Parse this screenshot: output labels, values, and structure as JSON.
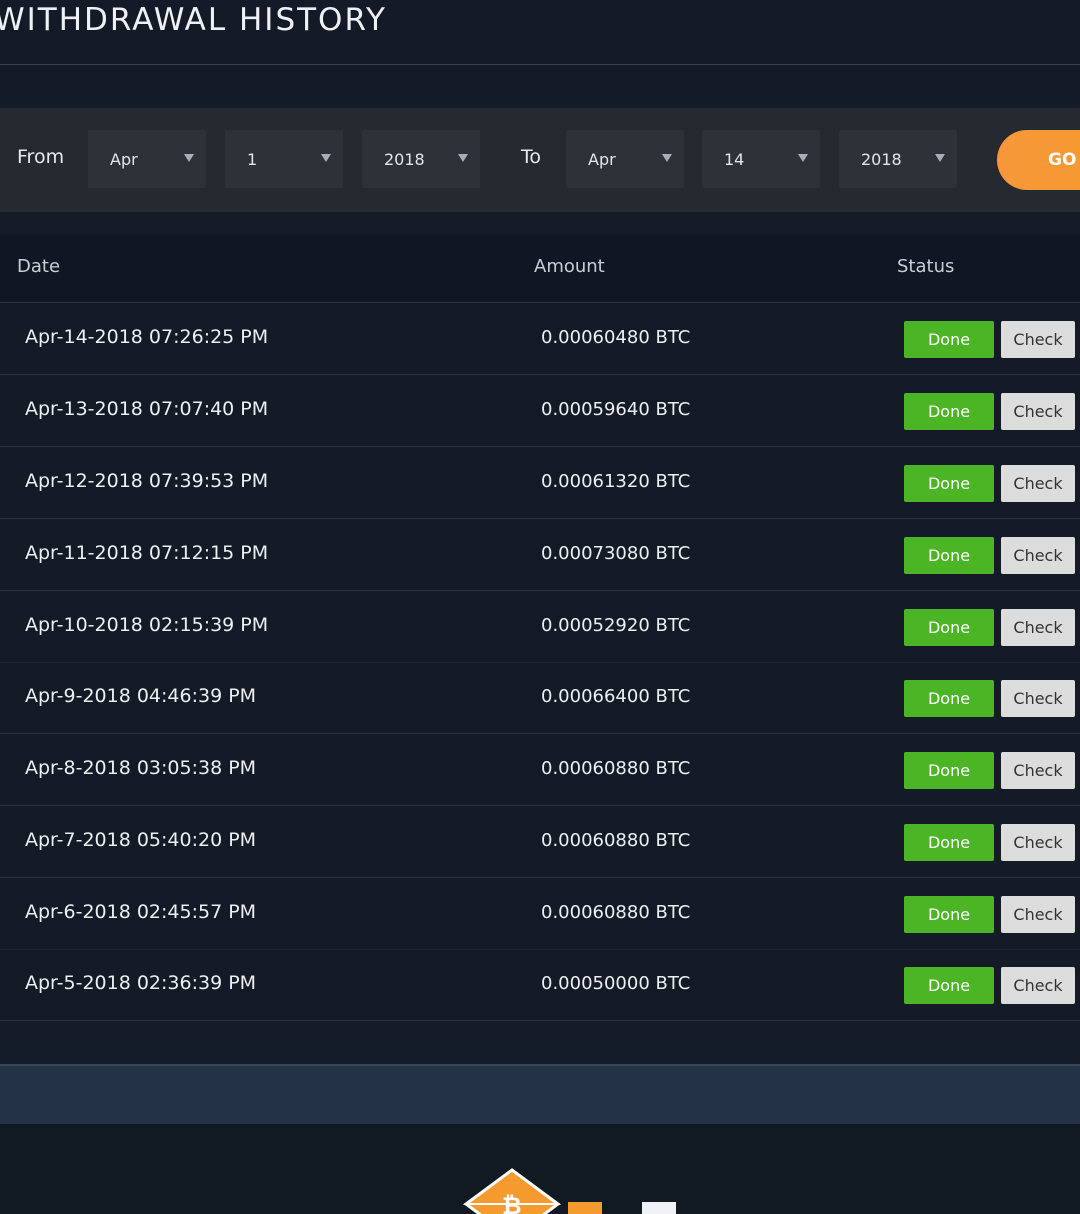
{
  "page": {
    "title": "WITHDRAWAL HISTORY"
  },
  "filter": {
    "from_label": "From",
    "to_label": "To",
    "from_month": "Apr",
    "from_day": "1",
    "from_year": "2018",
    "to_month": "Apr",
    "to_day": "14",
    "to_year": "2018",
    "go_label": "GO",
    "accent_color": "#f7973a"
  },
  "table": {
    "headers": {
      "date": "Date",
      "amount": "Amount",
      "status": "Status"
    },
    "done_color": "#4cb526",
    "rows": [
      {
        "date": "Apr-14-2018 07:26:25 PM",
        "amount": "0.00060480 BTC",
        "status": "Done",
        "action": "Check"
      },
      {
        "date": "Apr-13-2018 07:07:40 PM",
        "amount": "0.00059640 BTC",
        "status": "Done",
        "action": "Check"
      },
      {
        "date": "Apr-12-2018 07:39:53 PM",
        "amount": "0.00061320 BTC",
        "status": "Done",
        "action": "Check"
      },
      {
        "date": "Apr-11-2018 07:12:15 PM",
        "amount": "0.00073080 BTC",
        "status": "Done",
        "action": "Check"
      },
      {
        "date": "Apr-10-2018 02:15:39 PM",
        "amount": "0.00052920 BTC",
        "status": "Done",
        "action": "Check"
      },
      {
        "date": "Apr-9-2018 04:46:39 PM",
        "amount": "0.00066400 BTC",
        "status": "Done",
        "action": "Check"
      },
      {
        "date": "Apr-8-2018 03:05:38 PM",
        "amount": "0.00060880 BTC",
        "status": "Done",
        "action": "Check"
      },
      {
        "date": "Apr-7-2018 05:40:20 PM",
        "amount": "0.00060880 BTC",
        "status": "Done",
        "action": "Check"
      },
      {
        "date": "Apr-6-2018 02:45:57 PM",
        "amount": "0.00060880 BTC",
        "status": "Done",
        "action": "Check"
      },
      {
        "date": "Apr-5-2018 02:36:39 PM",
        "amount": "0.00050000 BTC",
        "status": "Done",
        "action": "Check"
      }
    ]
  },
  "footer": {
    "logo_icon": "bitcoin-diamond-logo-icon"
  }
}
